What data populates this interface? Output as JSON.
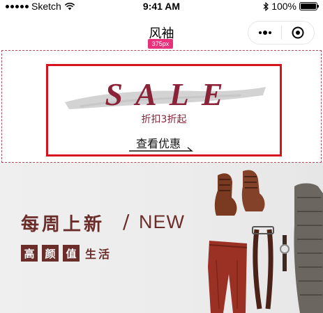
{
  "status_bar": {
    "carrier": "Sketch",
    "time": "9:41 AM",
    "battery": "100%",
    "battery_level": 1.0
  },
  "nav": {
    "title": "风袖",
    "width_badge": "375px"
  },
  "sale_banner": {
    "title": "SALE",
    "subtitle": "折扣3折起",
    "link": "查看优惠"
  },
  "hero": {
    "headline": "每周上新",
    "slash": "/",
    "new_label": "NEW",
    "tags": [
      "高",
      "颜",
      "值"
    ],
    "tag_tail": "生活"
  },
  "colors": {
    "accent": "#d9121f",
    "wine": "#8a2338",
    "brown": "#6b2d2a",
    "badge": "#e8317a"
  }
}
